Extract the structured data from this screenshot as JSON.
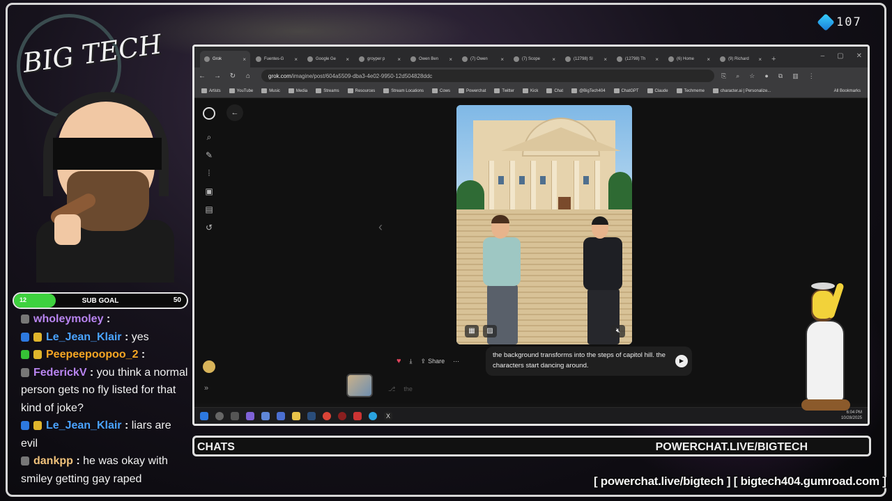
{
  "overlay": {
    "subscriber_count": "107",
    "logo_text": "BIG TECH",
    "sub_goal": {
      "label": "SUB GOAL",
      "current": "12",
      "target": "50",
      "progress": 0.24
    },
    "ticker_left": "CHATS",
    "ticker_right": "POWERCHAT.LIVE/BIGTECH",
    "footer_links": "[ powerchat.live/bigtech ] [ bigtech404.gumroad.com ]"
  },
  "chat": [
    {
      "user": "wholeymoley",
      "user_color": "#b884f0",
      "sep": " : ",
      "text": "",
      "badges": [
        "grey"
      ]
    },
    {
      "user": "Le_Jean_Klair",
      "user_color": "#4aa3ff",
      "sep": " : ",
      "text": "yes",
      "badges": [
        "blue",
        "gold"
      ]
    },
    {
      "user": "Peepeepoopoo_2",
      "user_color": "#f5a623",
      "sep": " : ",
      "text": "",
      "badges": [
        "green",
        "gold"
      ]
    },
    {
      "user": "FederickV",
      "user_color": "#b884f0",
      "sep": " : ",
      "text": "you think a normal person gets no fly listed for that kind of joke?",
      "badges": [
        "grey"
      ]
    },
    {
      "user": "Le_Jean_Klair",
      "user_color": "#4aa3ff",
      "sep": " : ",
      "text": "liars are evil",
      "badges": [
        "blue",
        "gold"
      ]
    },
    {
      "user": "dankpp",
      "user_color": "#f0c27b",
      "sep": " : ",
      "text": "he was okay with smiley getting gay raped",
      "badges": [
        "grey"
      ]
    }
  ],
  "browser": {
    "tabs": [
      {
        "label": "Grok",
        "active": true
      },
      {
        "label": "Fuentes-G",
        "active": false
      },
      {
        "label": "Google Ge",
        "active": false
      },
      {
        "label": "groyper p",
        "active": false
      },
      {
        "label": "Owen Ben",
        "active": false
      },
      {
        "label": "(7) Owen",
        "active": false
      },
      {
        "label": "(7) Scope",
        "active": false
      },
      {
        "label": "(12798) Sl",
        "active": false
      },
      {
        "label": "(12798) Th",
        "active": false
      },
      {
        "label": "(6) Home",
        "active": false
      },
      {
        "label": "(9) Richard",
        "active": false
      }
    ],
    "url_site": "grok.com",
    "url_path": "/imagine/post/604a5509-dba3-4e02-9950-12d504828ddc",
    "bookmarks": [
      "Artists",
      "YouTube",
      "Music",
      "Media",
      "Streams",
      "Resources",
      "Stream Locations",
      "Cows",
      "Powerchat",
      "Twitter",
      "Kick",
      "Chat",
      "@BigTech404",
      "ChatGPT",
      "Claude",
      "Techmeme",
      "character.ai | Personalize..."
    ],
    "all_bookmarks": "All Bookmarks"
  },
  "grok": {
    "actions": {
      "share_label": "Share"
    },
    "prompt": "the background transforms into the steps of capitol hill. the characters start dancing around.",
    "input_placeholder": "the"
  },
  "taskbar": {
    "time": "6:04 PM",
    "date": "10/28/2025"
  },
  "colors": {
    "accent_green": "#3ed23e",
    "heart": "#e0445c",
    "tab_bg": "#2a2a2c"
  }
}
